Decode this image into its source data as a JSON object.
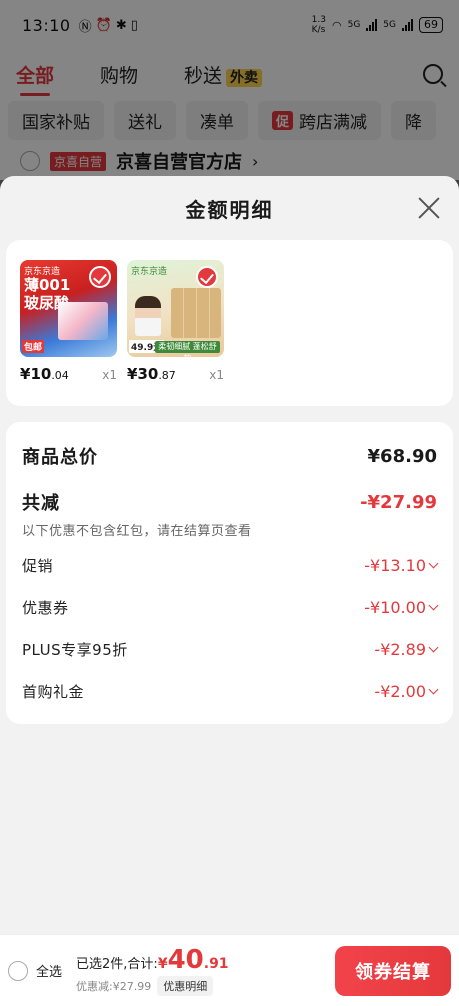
{
  "status": {
    "time": "13:10",
    "net_speed_top": "1.3",
    "net_speed_unit": "K/s",
    "sig1": "5G",
    "sig2": "5G",
    "battery": "69"
  },
  "top_tabs": {
    "all": "全部",
    "shopping": "购物",
    "express": "秒送",
    "express_badge": "外卖"
  },
  "chips": [
    "国家补贴",
    "送礼",
    "凑单",
    "跨店满减",
    "降"
  ],
  "chips_promo_icon": "促",
  "shop": {
    "tag": "京喜自营",
    "name": "京喜自营官方店",
    "arrow": "›"
  },
  "sheet": {
    "title": "金额明细"
  },
  "products": [
    {
      "img_line1": "京东京造",
      "img_line2": "薄001",
      "img_line3": "玻尿酸",
      "img_badge": "包邮",
      "price_symbol": "¥",
      "price_int": "10",
      "price_dec": ".04",
      "qty": "x1"
    },
    {
      "img_line1": "京东京造",
      "img_price": "49.9元",
      "img_bar": "柔韧细腻 蓬松舒软",
      "price_symbol": "¥",
      "price_int": "30",
      "price_dec": ".87",
      "qty": "x1"
    }
  ],
  "summary": {
    "total_label": "商品总价",
    "total_value": "¥68.90",
    "reduce_label": "共减",
    "reduce_value": "-¥27.99",
    "note": "以下优惠不包含红包，请在结算页查看",
    "items": [
      {
        "label": "促销",
        "value": "-¥13.10"
      },
      {
        "label": "优惠券",
        "value": "-¥10.00"
      },
      {
        "label": "PLUS专享95折",
        "value": "-¥2.89"
      },
      {
        "label": "首购礼金",
        "value": "-¥2.00"
      }
    ]
  },
  "bottom": {
    "select_all": "全选",
    "selected_text": "已选2件,合计:",
    "price_symbol": "¥",
    "price_int": "40",
    "price_dec": ".91",
    "discount_text": "优惠减:¥27.99",
    "detail_btn": "优惠明细",
    "checkout_btn": "领券结算"
  },
  "colors": {
    "accent": "#e4393c",
    "sheet_bg": "#f2f2f2"
  }
}
